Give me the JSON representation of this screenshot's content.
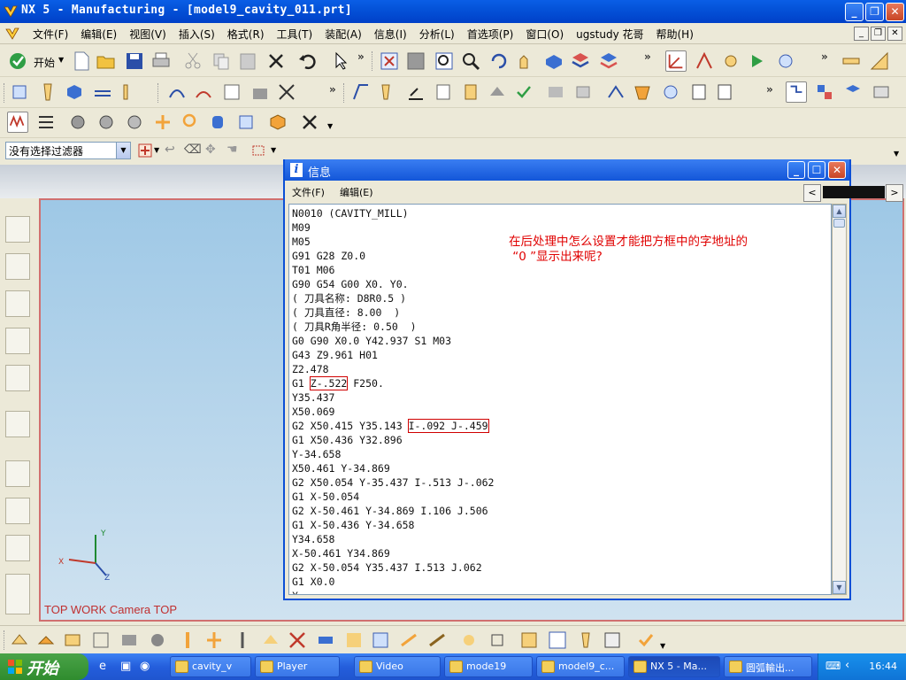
{
  "window": {
    "title": "NX 5 - Manufacturing - [model9_cavity_011.prt]"
  },
  "menubar": {
    "items": [
      "文件(F)",
      "编辑(E)",
      "视图(V)",
      "插入(S)",
      "格式(R)",
      "工具(T)",
      "装配(A)",
      "信息(I)",
      "分析(L)",
      "首选项(P)",
      "窗口(O)",
      "ugstudy 花哥",
      "帮助(H)"
    ]
  },
  "toolbar": {
    "start_label": "开始"
  },
  "filter": {
    "value": "没有选择过滤器"
  },
  "viewport": {
    "caption": "TOP WORK Camera TOP",
    "axis_x": "X",
    "axis_y": "Y",
    "axis_z": "Z"
  },
  "info_window": {
    "title": "信息",
    "menu_file": "文件(F)",
    "menu_edit": "编辑(E)",
    "lines_before": "N0010 (CAVITY_MILL)\nM09\nM05\nG91 G28 Z0.0\nT01 M06\nG90 G54 G00 X0. Y0.\n( 刀具名称: D8R0.5 )\n( 刀具直径: 8.00  )\n( 刀具R角半径: 0.50  )\nG0 G90 X0.0 Y42.937 S1 M03\nG43 Z9.961 H01\nZ2.478\n",
    "line_g1_prefix": "G1 ",
    "line_g1_boxed": "Z-.522",
    "line_g1_suffix": " F250.\n",
    "lines_mid": "Y35.437\nX50.069\n",
    "line_g2_prefix": "G2 X50.415 Y35.143 ",
    "line_g2_boxed": "I-.092 J-.459",
    "line_g2_suffix": "\n",
    "lines_after": "G1 X50.436 Y32.896\nY-34.658\nX50.461 Y-34.869\nG2 X50.054 Y-35.437 I-.513 J-.062\nG1 X-50.054\nG2 X-50.461 Y-34.869 I.106 J.506\nG1 X-50.436 Y-34.658\nY34.658\nX-50.461 Y34.869\nG2 X-50.054 Y35.437 I.513 J.062\nG1 X0.0\nX…",
    "question": "在后处理中怎么设置才能把方框中的字地址的\n “0 ”显示出来呢?"
  },
  "taskbar": {
    "start": "开始",
    "tasks": [
      "cavity_v",
      "Player",
      "Video",
      "mode19",
      "model9_c...",
      "NX 5 - Ma...",
      "圆弧輸出..."
    ],
    "clock": "16:44"
  },
  "colors": {
    "title_blue": "#0452d8",
    "question_red": "#e00000",
    "viewport_border": "#d07070"
  }
}
